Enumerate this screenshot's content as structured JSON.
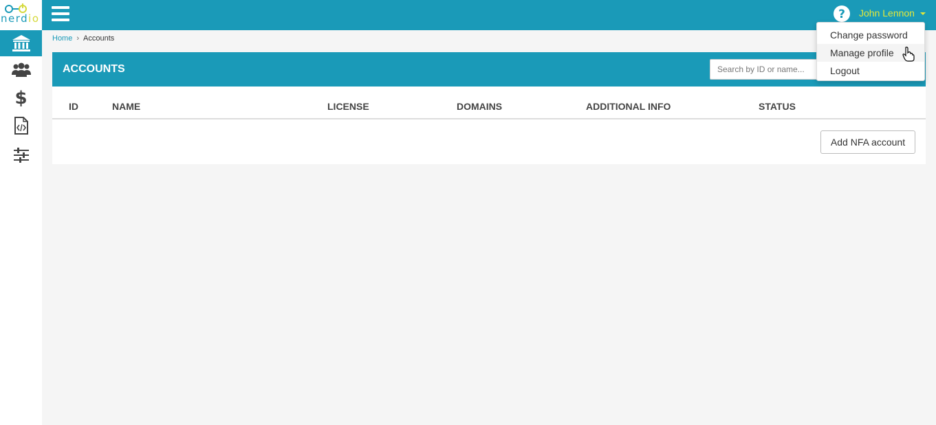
{
  "brand": {
    "logo_text": "nerd",
    "logo_text_accent": "io",
    "primary": "#1a9ab8",
    "accent": "#e4e838"
  },
  "sidebar": {
    "items": [
      {
        "icon": "bank-icon",
        "active": true
      },
      {
        "icon": "users-icon",
        "active": false
      },
      {
        "icon": "dollar-icon",
        "active": false
      },
      {
        "icon": "code-file-icon",
        "active": false
      },
      {
        "icon": "sliders-icon",
        "active": false
      }
    ],
    "dollar_glyph": "$"
  },
  "topbar": {
    "user_name": "John Lennon",
    "help_glyph": "?"
  },
  "user_menu": {
    "items": [
      "Change password",
      "Manage profile",
      "Logout"
    ],
    "hovered": "Manage profile"
  },
  "breadcrumb": {
    "home": "Home",
    "separator": "›",
    "current": "Accounts"
  },
  "panel": {
    "title": "ACCOUNTS",
    "search_placeholder": "Search by ID or name..."
  },
  "table": {
    "columns": [
      "ID",
      "NAME",
      "LICENSE",
      "DOMAINS",
      "ADDITIONAL INFO",
      "STATUS"
    ],
    "rows": []
  },
  "actions": {
    "add_account": "Add NFA account"
  }
}
